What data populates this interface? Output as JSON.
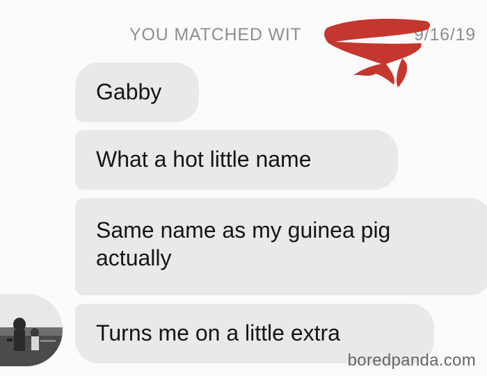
{
  "header": {
    "match_text": "YOU MATCHED WIT",
    "match_date": "9/16/19"
  },
  "messages": [
    {
      "lines": [
        "Gabby"
      ]
    },
    {
      "lines": [
        "What a hot little name"
      ]
    },
    {
      "lines": [
        "Same name as my guinea pig",
        "actually"
      ]
    },
    {
      "lines": [
        "Turns me on a little extra"
      ]
    }
  ],
  "watermark": "boredpanda.com",
  "colors": {
    "bubble": "#e9e9eb",
    "redaction": "#c4372f",
    "header_text": "#8e8e8e"
  },
  "icons": {
    "avatar": "profile-photo",
    "redaction": "scribble-redaction"
  }
}
